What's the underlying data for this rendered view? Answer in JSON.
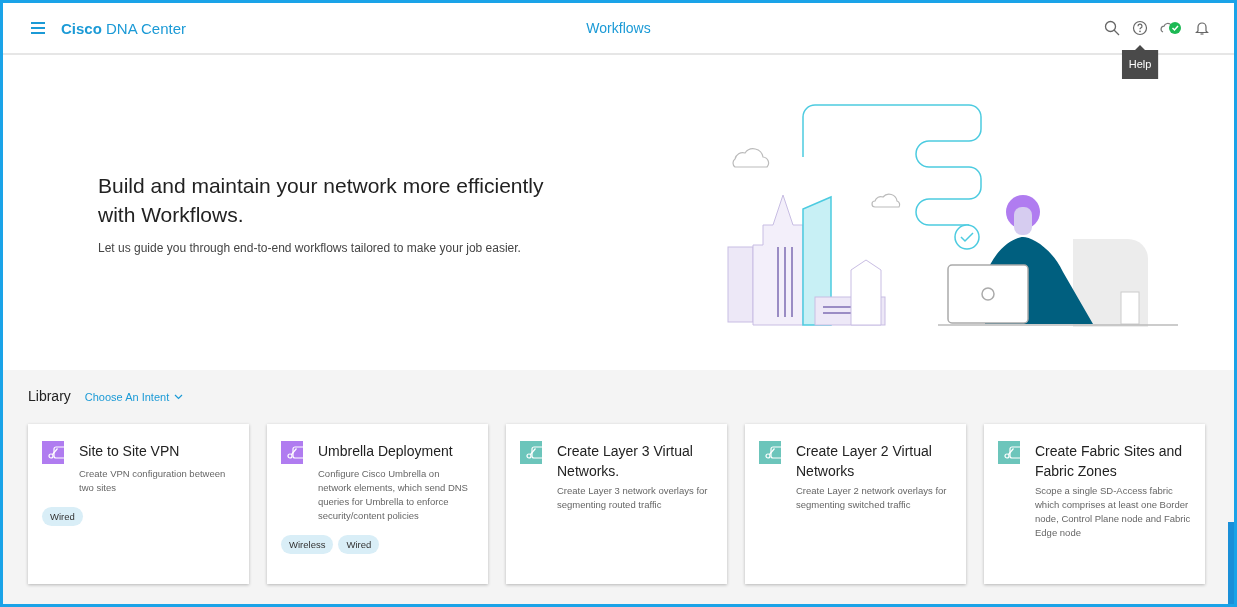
{
  "header": {
    "brand_bold": "Cisco",
    "brand_rest": "DNA Center",
    "title": "Workflows",
    "tooltip": "Help",
    "cloud_status_ok": true
  },
  "hero": {
    "headline": "Build and maintain your network more efficiently with Workflows.",
    "subtext": "Let us guide you through end-to-end workflows tailored to make your job easier."
  },
  "library": {
    "title": "Library",
    "filter": "Choose An Intent",
    "cards": [
      {
        "title": "Site to Site VPN",
        "description": "Create VPN configuration between two sites",
        "color": "#b07cf0",
        "tags": [
          "Wired"
        ]
      },
      {
        "title": "Umbrella Deployment",
        "description": "Configure Cisco Umbrella on network elements, which send DNS queries for Umbrella to enforce security/content policies",
        "color": "#b07cf0",
        "tags": [
          "Wireless",
          "Wired"
        ]
      },
      {
        "title": "Create Layer 3 Virtual Networks.",
        "description": "Create Layer 3 network overlays for segmenting routed traffic",
        "color": "#6cc5bb"
      },
      {
        "title": "Create Layer 2 Virtual Networks",
        "description": "Create Layer 2 network overlays for segmenting switched traffic",
        "color": "#6cc5bb"
      },
      {
        "title": "Create Fabric Sites and Fabric Zones",
        "description": "Scope a single SD-Access fabric which comprises at least one Border node, Control Plane node and Fabric Edge node",
        "color": "#6cc5bb"
      }
    ]
  }
}
